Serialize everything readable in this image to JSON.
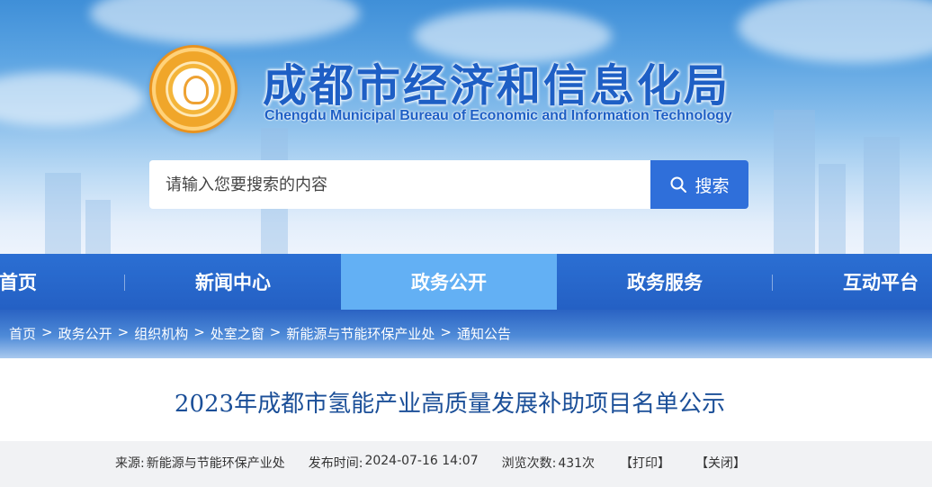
{
  "header": {
    "logo_icon": "chengdu-sun-bird-seal",
    "title_cn": "成都市经济和信息化局",
    "title_en": "Chengdu Municipal Bureau of Economic and Information Technology"
  },
  "search": {
    "placeholder": "请输入您要搜索的内容",
    "value": "",
    "button_label": "搜索",
    "button_icon": "search-icon"
  },
  "nav": {
    "items": [
      {
        "label": "首页",
        "active": false
      },
      {
        "label": "新闻中心",
        "active": false
      },
      {
        "label": "政务公开",
        "active": true
      },
      {
        "label": "政务服务",
        "active": false
      },
      {
        "label": "互动平台",
        "active": false
      }
    ]
  },
  "breadcrumb": {
    "separator": ">",
    "items": [
      "首页",
      "政务公开",
      "组织机构",
      "处室之窗",
      "新能源与节能环保产业处",
      "通知公告"
    ]
  },
  "article": {
    "title": "2023年成都市氢能产业高质量发展补助项目名单公示",
    "source_label": "来源:",
    "source_value": "新能源与节能环保产业处",
    "publish_label": "发布时间:",
    "publish_value": "2024-07-16 14:07",
    "views_label": "浏览次数:",
    "views_value": "431次",
    "print_label": "【打印】",
    "close_label": "【关闭】"
  },
  "colors": {
    "brand_blue": "#1e5fc5",
    "nav_blue": "#2b6fd3",
    "nav_active": "#63b0f4",
    "search_button": "#2f6fda",
    "article_title": "#1b4f98",
    "logo_gold": "#f0a62a"
  }
}
